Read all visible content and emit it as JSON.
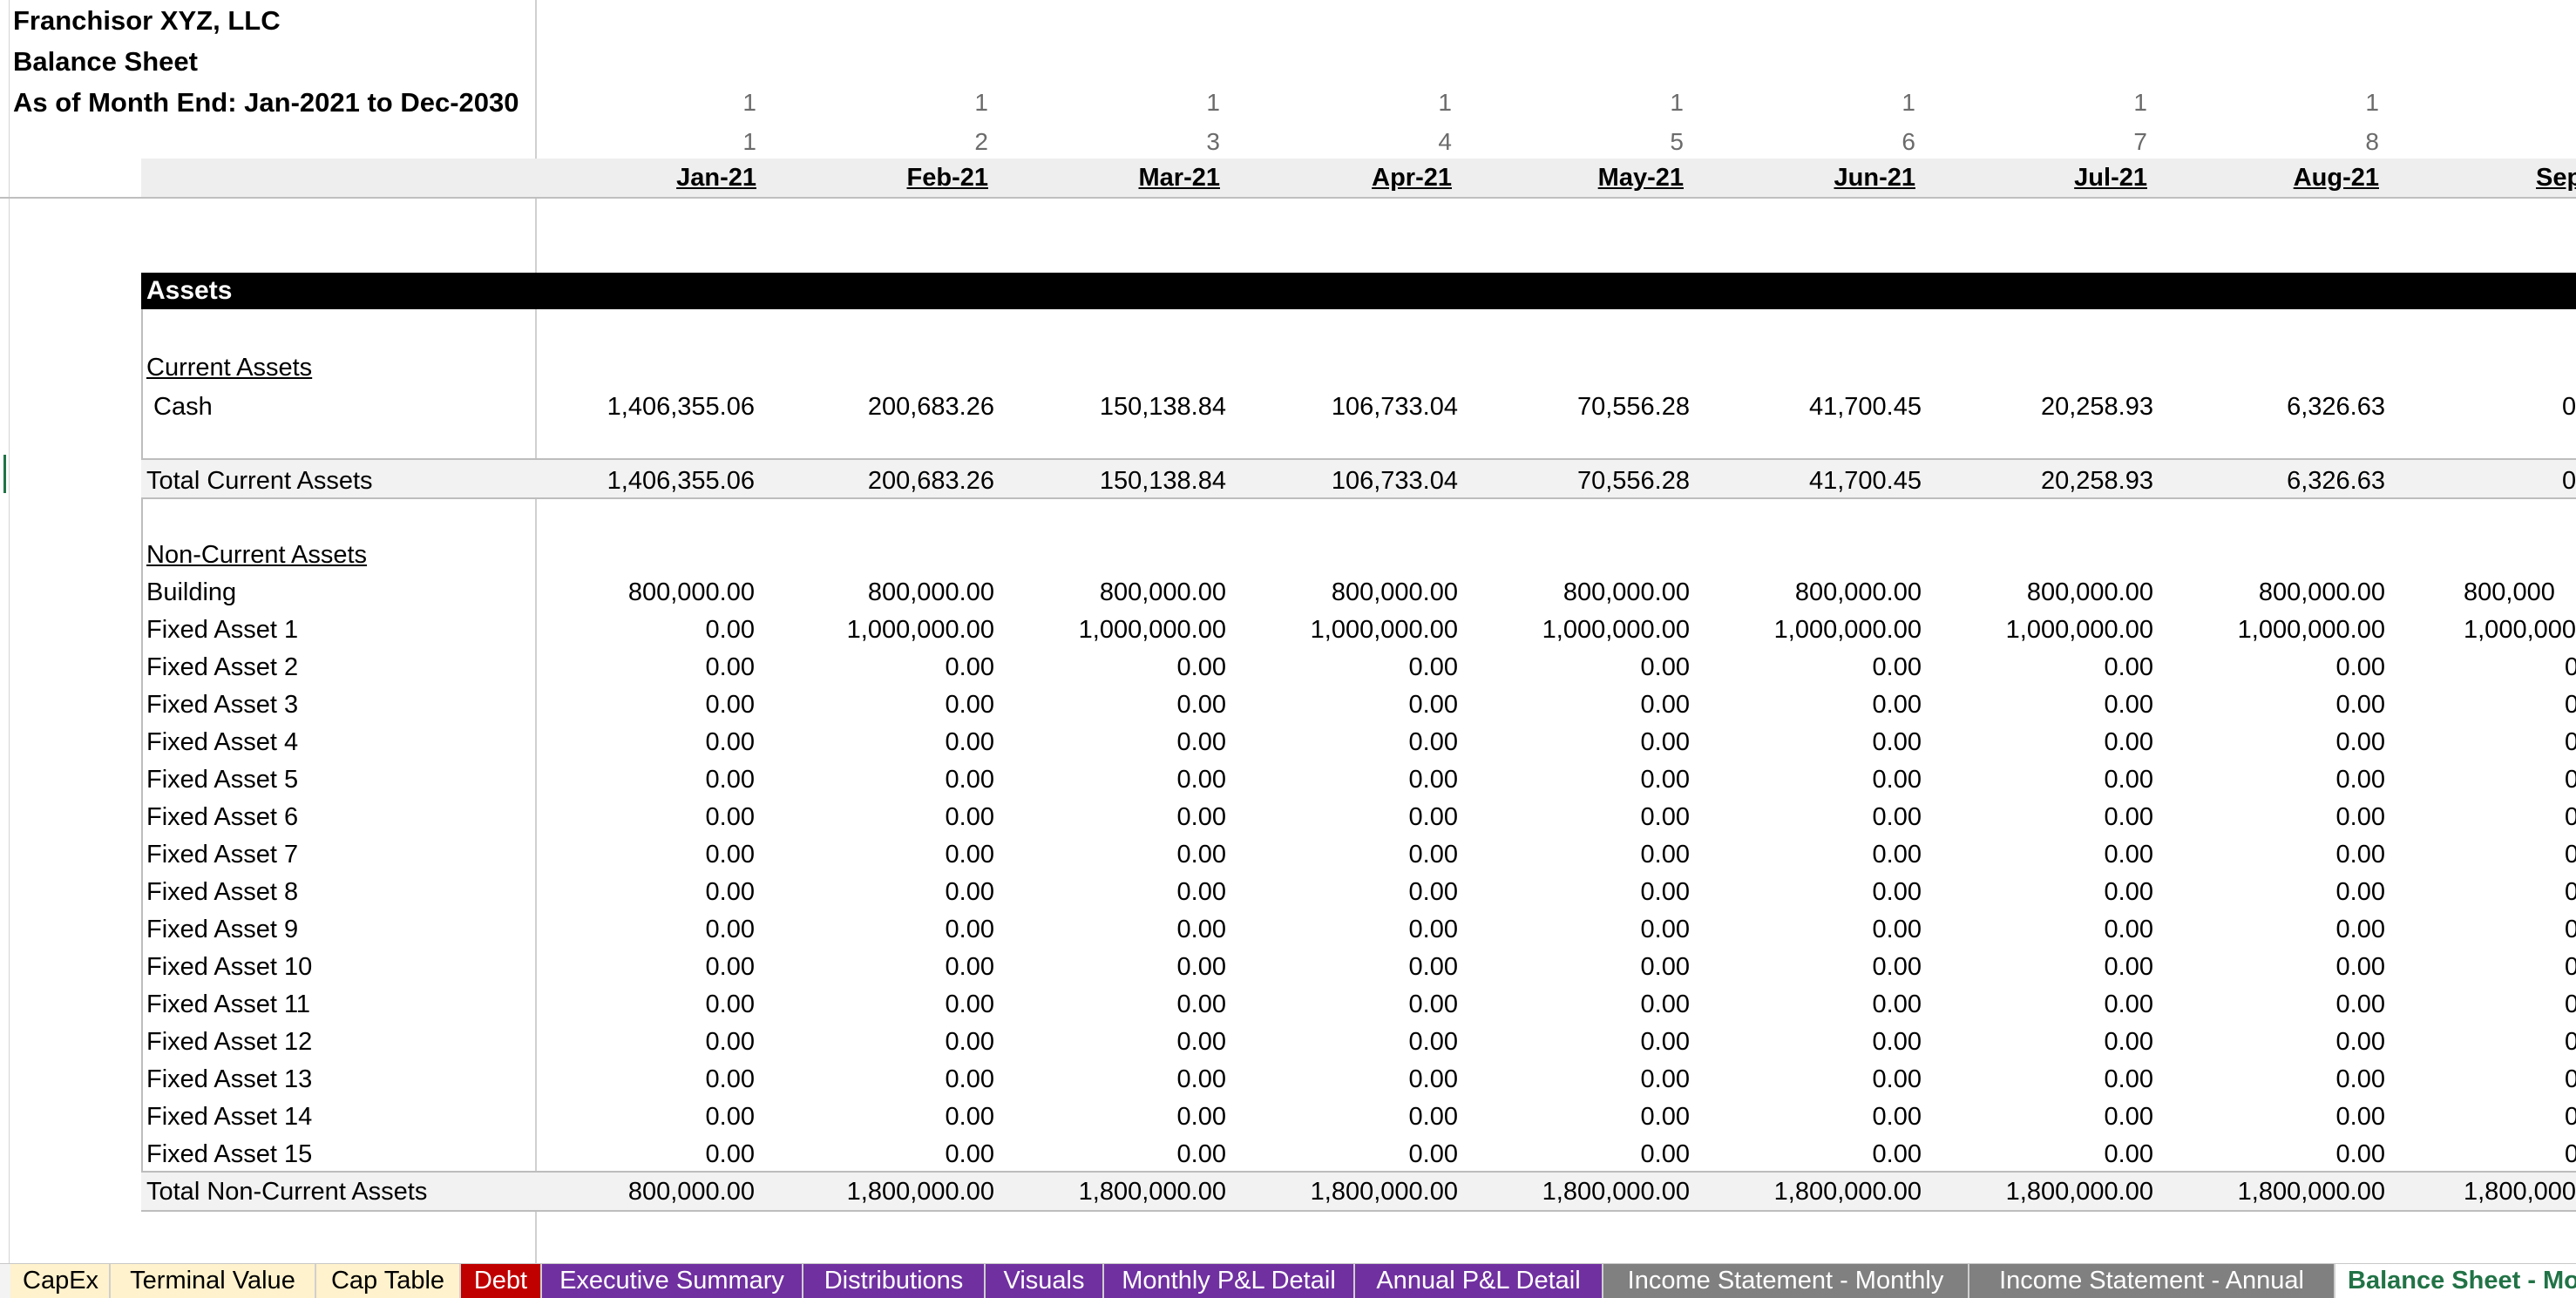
{
  "header": {
    "company": "Franchisor XYZ, LLC",
    "report": "Balance Sheet",
    "period": "As of Month End: Jan-2021 to Dec-2030"
  },
  "columns": [
    {
      "n1": "1",
      "n2": "1",
      "date": "Jan-21"
    },
    {
      "n1": "1",
      "n2": "2",
      "date": "Feb-21"
    },
    {
      "n1": "1",
      "n2": "3",
      "date": "Mar-21"
    },
    {
      "n1": "1",
      "n2": "4",
      "date": "Apr-21"
    },
    {
      "n1": "1",
      "n2": "5",
      "date": "May-21"
    },
    {
      "n1": "1",
      "n2": "6",
      "date": "Jun-21"
    },
    {
      "n1": "1",
      "n2": "7",
      "date": "Jul-21"
    },
    {
      "n1": "1",
      "n2": "8",
      "date": "Aug-21"
    },
    {
      "n1": "",
      "n2": "",
      "date": "Sep"
    }
  ],
  "sections": {
    "assets": "Assets",
    "current_assets": "Current Assets",
    "non_current_assets": "Non-Current Assets"
  },
  "rows": [
    {
      "label": "Cash",
      "values": [
        "1,406,355.06",
        "200,683.26",
        "150,138.84",
        "106,733.04",
        "70,556.28",
        "41,700.45",
        "20,258.93",
        "6,326.63",
        "0."
      ]
    },
    {
      "label": "Total Current Assets",
      "values": [
        "1,406,355.06",
        "200,683.26",
        "150,138.84",
        "106,733.04",
        "70,556.28",
        "41,700.45",
        "20,258.93",
        "6,326.63",
        "0."
      ]
    },
    {
      "label": "Building",
      "values": [
        "800,000.00",
        "800,000.00",
        "800,000.00",
        "800,000.00",
        "800,000.00",
        "800,000.00",
        "800,000.00",
        "800,000.00",
        "800,000"
      ]
    },
    {
      "label": "Fixed Asset 1",
      "values": [
        "0.00",
        "1,000,000.00",
        "1,000,000.00",
        "1,000,000.00",
        "1,000,000.00",
        "1,000,000.00",
        "1,000,000.00",
        "1,000,000.00",
        "1,000,000"
      ]
    },
    {
      "label": "Fixed Asset 2",
      "values": [
        "0.00",
        "0.00",
        "0.00",
        "0.00",
        "0.00",
        "0.00",
        "0.00",
        "0.00",
        "0"
      ]
    },
    {
      "label": "Fixed Asset 3",
      "values": [
        "0.00",
        "0.00",
        "0.00",
        "0.00",
        "0.00",
        "0.00",
        "0.00",
        "0.00",
        "0"
      ]
    },
    {
      "label": "Fixed Asset 4",
      "values": [
        "0.00",
        "0.00",
        "0.00",
        "0.00",
        "0.00",
        "0.00",
        "0.00",
        "0.00",
        "0"
      ]
    },
    {
      "label": "Fixed Asset 5",
      "values": [
        "0.00",
        "0.00",
        "0.00",
        "0.00",
        "0.00",
        "0.00",
        "0.00",
        "0.00",
        "0"
      ]
    },
    {
      "label": "Fixed Asset 6",
      "values": [
        "0.00",
        "0.00",
        "0.00",
        "0.00",
        "0.00",
        "0.00",
        "0.00",
        "0.00",
        "0"
      ]
    },
    {
      "label": "Fixed Asset 7",
      "values": [
        "0.00",
        "0.00",
        "0.00",
        "0.00",
        "0.00",
        "0.00",
        "0.00",
        "0.00",
        "0"
      ]
    },
    {
      "label": "Fixed Asset 8",
      "values": [
        "0.00",
        "0.00",
        "0.00",
        "0.00",
        "0.00",
        "0.00",
        "0.00",
        "0.00",
        "0"
      ]
    },
    {
      "label": "Fixed Asset 9",
      "values": [
        "0.00",
        "0.00",
        "0.00",
        "0.00",
        "0.00",
        "0.00",
        "0.00",
        "0.00",
        "0"
      ]
    },
    {
      "label": "Fixed Asset 10",
      "values": [
        "0.00",
        "0.00",
        "0.00",
        "0.00",
        "0.00",
        "0.00",
        "0.00",
        "0.00",
        "0"
      ]
    },
    {
      "label": "Fixed Asset 11",
      "values": [
        "0.00",
        "0.00",
        "0.00",
        "0.00",
        "0.00",
        "0.00",
        "0.00",
        "0.00",
        "0"
      ]
    },
    {
      "label": "Fixed Asset 12",
      "values": [
        "0.00",
        "0.00",
        "0.00",
        "0.00",
        "0.00",
        "0.00",
        "0.00",
        "0.00",
        "0"
      ]
    },
    {
      "label": "Fixed Asset 13",
      "values": [
        "0.00",
        "0.00",
        "0.00",
        "0.00",
        "0.00",
        "0.00",
        "0.00",
        "0.00",
        "0"
      ]
    },
    {
      "label": "Fixed Asset 14",
      "values": [
        "0.00",
        "0.00",
        "0.00",
        "0.00",
        "0.00",
        "0.00",
        "0.00",
        "0.00",
        "0"
      ]
    },
    {
      "label": "Fixed Asset 15",
      "values": [
        "0.00",
        "0.00",
        "0.00",
        "0.00",
        "0.00",
        "0.00",
        "0.00",
        "0.00",
        "0"
      ]
    },
    {
      "label": "Total Non-Current Assets",
      "values": [
        "800,000.00",
        "1,800,000.00",
        "1,800,000.00",
        "1,800,000.00",
        "1,800,000.00",
        "1,800,000.00",
        "1,800,000.00",
        "1,800,000.00",
        "1,800,000"
      ]
    }
  ],
  "tabs": [
    {
      "label": "CapEx",
      "bg": "#fff2cc",
      "fg": "#000000"
    },
    {
      "label": "Terminal Value",
      "bg": "#fff2cc",
      "fg": "#000000"
    },
    {
      "label": "Cap Table",
      "bg": "#fff2cc",
      "fg": "#000000"
    },
    {
      "label": "Debt",
      "bg": "#c00000",
      "fg": "#ffffff"
    },
    {
      "label": "Executive Summary",
      "bg": "#7030a0",
      "fg": "#ffffff"
    },
    {
      "label": "Distributions",
      "bg": "#7030a0",
      "fg": "#ffffff"
    },
    {
      "label": "Visuals",
      "bg": "#7030a0",
      "fg": "#ffffff"
    },
    {
      "label": "Monthly P&L Detail",
      "bg": "#7030a0",
      "fg": "#ffffff"
    },
    {
      "label": "Annual P&L Detail",
      "bg": "#7030a0",
      "fg": "#ffffff"
    },
    {
      "label": "Income Statement - Monthly",
      "bg": "#808080",
      "fg": "#ffffff"
    },
    {
      "label": "Income Statement - Annual",
      "bg": "#808080",
      "fg": "#ffffff"
    },
    {
      "label": "Balance Sheet - Mo",
      "bg": "#ffffff",
      "fg": "#217346",
      "active": true
    }
  ]
}
